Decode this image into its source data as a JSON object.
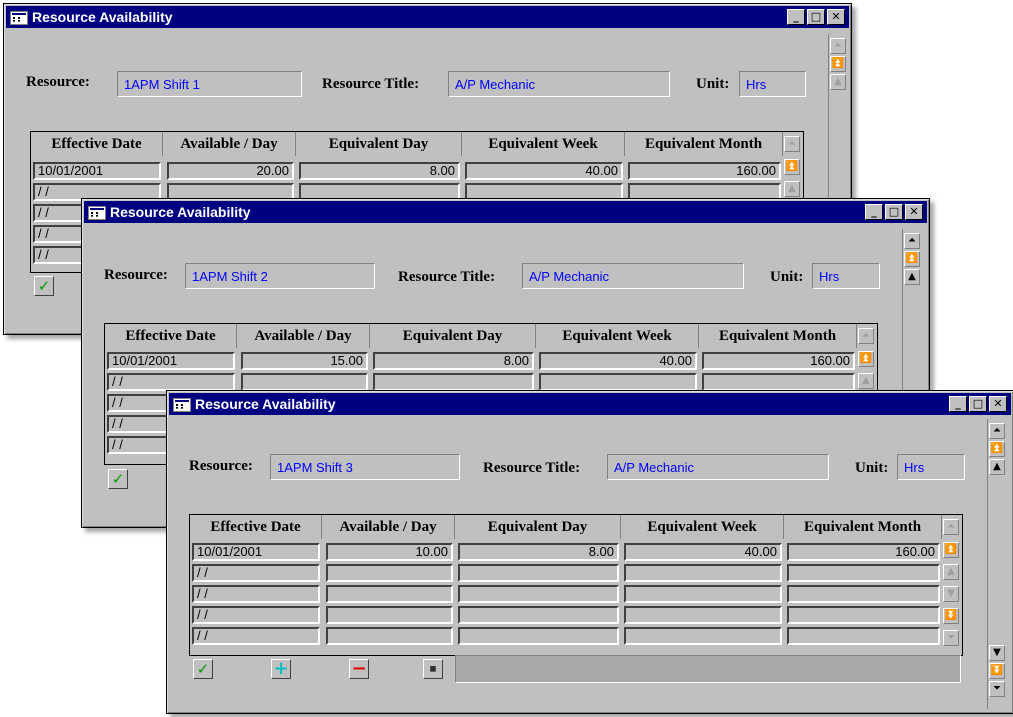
{
  "window_title": "Resource Availability",
  "title_buttons": {
    "minimize": "_",
    "maximize": "□",
    "close": "✕"
  },
  "labels": {
    "resource": "Resource:",
    "resource_title": "Resource Title:",
    "unit": "Unit:"
  },
  "columns": [
    "Effective Date",
    "Available / Day",
    "Equivalent Day",
    "Equivalent Week",
    "Equivalent Month"
  ],
  "windows": [
    {
      "resource": "1APM Shift 1",
      "resource_title": "A/P Mechanic",
      "unit": "Hrs",
      "rows": [
        [
          "10/01/2001",
          "20.00",
          "8.00",
          "40.00",
          "160.00"
        ],
        [
          " / /",
          "",
          "",
          "",
          ""
        ],
        [
          " / /",
          "",
          "",
          "",
          ""
        ],
        [
          " / /",
          "",
          "",
          "",
          ""
        ],
        [
          " / /",
          "",
          "",
          "",
          ""
        ]
      ]
    },
    {
      "resource": "1APM Shift 2",
      "resource_title": "A/P Mechanic",
      "unit": "Hrs",
      "rows": [
        [
          "10/01/2001",
          "15.00",
          "8.00",
          "40.00",
          "160.00"
        ],
        [
          " / /",
          "",
          "",
          "",
          ""
        ],
        [
          " / /",
          "",
          "",
          "",
          ""
        ],
        [
          " / /",
          "",
          "",
          "",
          ""
        ],
        [
          " / /",
          "",
          "",
          "",
          ""
        ]
      ]
    },
    {
      "resource": "1APM Shift 3",
      "resource_title": "A/P Mechanic",
      "unit": "Hrs",
      "rows": [
        [
          "10/01/2001",
          "10.00",
          "8.00",
          "40.00",
          "160.00"
        ],
        [
          " / /",
          "",
          "",
          "",
          ""
        ],
        [
          " / /",
          "",
          "",
          "",
          ""
        ],
        [
          " / /",
          "",
          "",
          "",
          ""
        ],
        [
          " / /",
          "",
          "",
          "",
          ""
        ]
      ]
    }
  ],
  "toolbar_icons": [
    "check-icon",
    "plus-icon",
    "minus-icon",
    "calculator-icon"
  ],
  "icon_glyphs": {
    "check": "✓",
    "plus": "+",
    "minus": "−",
    "calc": "▦"
  },
  "scroll_glyphs": {
    "top": "⏶",
    "page_up": "⏫",
    "up": "▲",
    "down": "▼",
    "page_down": "⏬",
    "bottom": "⏷"
  },
  "colors": {
    "titlebar": "#000080",
    "window_bg": "#c0c0c0",
    "field_text": "#0000ff"
  }
}
